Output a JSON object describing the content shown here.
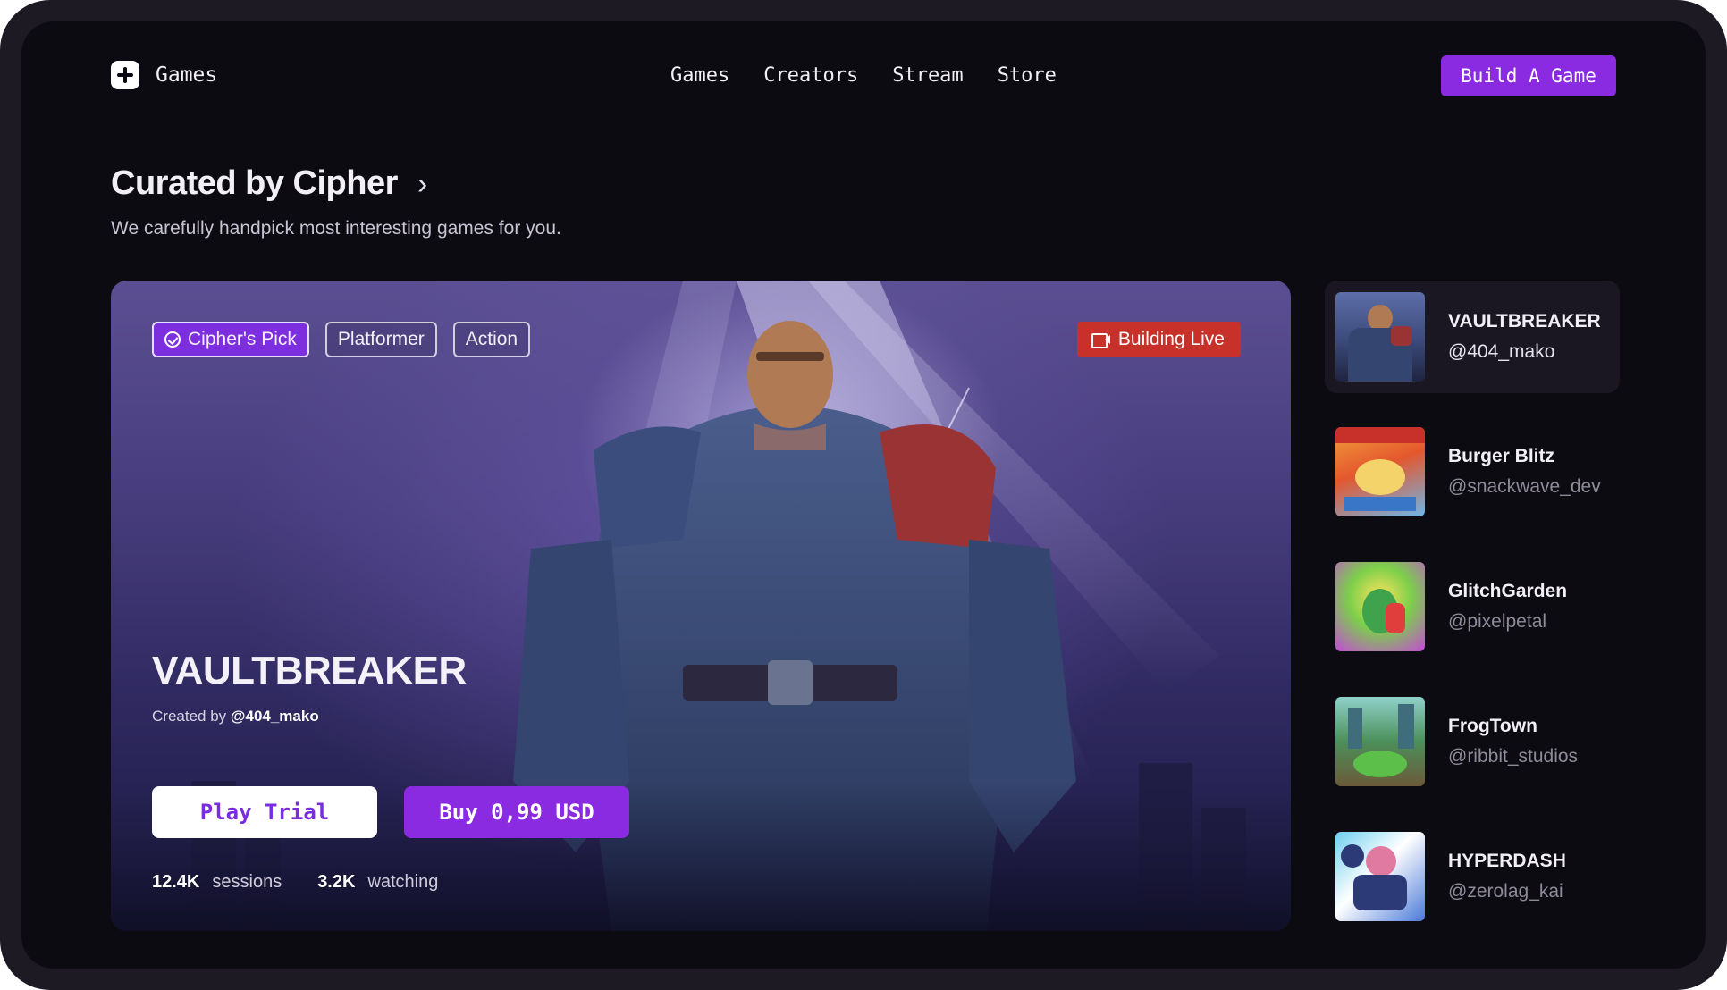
{
  "header": {
    "logo_text": "Games",
    "nav": [
      "Games",
      "Creators",
      "Stream",
      "Store"
    ],
    "cta_label": "Build A Game"
  },
  "section": {
    "title": "Curated by Cipher",
    "subtitle": "We carefully handpick most interesting games for you."
  },
  "featured": {
    "tags": [
      "Cipher's Pick",
      "Platformer",
      "Action"
    ],
    "live_label": "Building Live",
    "title": "VAULTBREAKER",
    "created_by_prefix": "Created by",
    "creator": "@404_mako",
    "trial_label": "Play Trial",
    "buy_label": "Buy 0,99 USD",
    "stats": [
      {
        "value": "12.4K",
        "label": "sessions"
      },
      {
        "value": "3.2K",
        "label": "watching"
      }
    ]
  },
  "games": [
    {
      "name": "VAULTBREAKER",
      "handle": "@404_mako",
      "active": true
    },
    {
      "name": "Burger Blitz",
      "handle": "@snackwave_dev",
      "active": false
    },
    {
      "name": "GlitchGarden",
      "handle": "@pixelpetal",
      "active": false
    },
    {
      "name": "FrogTown",
      "handle": "@ribbit_studios",
      "active": false
    },
    {
      "name": "HYPERDASH",
      "handle": "@zerolag_kai",
      "active": false
    }
  ],
  "colors": {
    "accent": "#8a2be2",
    "live": "#c8302a",
    "background": "#0d0b12"
  }
}
